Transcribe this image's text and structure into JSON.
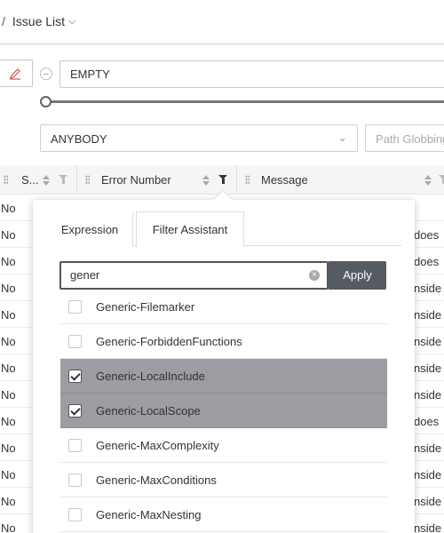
{
  "breadcrumb": {
    "separator": "/",
    "current": "Issue List",
    "chevron": "⌵"
  },
  "filter_bar": {
    "expression_value": "EMPTY",
    "assignee_value": "ANYBODY",
    "path_placeholder": "Path Globbing",
    "slider_value": 0
  },
  "table": {
    "columns": [
      {
        "label": "S...",
        "sort_icon": "sort-icon",
        "filter_icon": "filter-icon"
      },
      {
        "label": "Error Number",
        "sort_icon": "sort-icon",
        "filter_icon": "filter-icon",
        "filter_active": true
      },
      {
        "label": "Message",
        "sort_icon": "sort-icon",
        "filter_icon": "filter-icon"
      }
    ],
    "rows": [
      {
        "c1": "No",
        "c3": ""
      },
      {
        "c1": "No",
        "c3": "does"
      },
      {
        "c1": "No",
        "c3": "does"
      },
      {
        "c1": "No",
        "c3": "nside"
      },
      {
        "c1": "No",
        "c3": "nside"
      },
      {
        "c1": "No",
        "c3": "nside"
      },
      {
        "c1": "No",
        "c3": "nside"
      },
      {
        "c1": "No",
        "c3": "nside"
      },
      {
        "c1": "No",
        "c3": "does"
      },
      {
        "c1": "No",
        "c3": "nside"
      },
      {
        "c1": "No",
        "c3": "nside"
      },
      {
        "c1": "No",
        "c3": "nside"
      },
      {
        "c1": "No",
        "c3": "nside"
      }
    ]
  },
  "popup": {
    "tabs": [
      "Expression",
      "Filter Assistant"
    ],
    "active_tab": "Filter Assistant",
    "search_value": "gener",
    "clear_glyph": "×",
    "apply_label": "Apply",
    "options": [
      {
        "label": "Generic-Filemarker",
        "checked": false
      },
      {
        "label": "Generic-ForbiddenFunctions",
        "checked": false
      },
      {
        "label": "Generic-LocalInclude",
        "checked": true
      },
      {
        "label": "Generic-LocalScope",
        "checked": true
      },
      {
        "label": "Generic-MaxComplexity",
        "checked": false
      },
      {
        "label": "Generic-MaxConditions",
        "checked": false
      },
      {
        "label": "Generic-MaxNesting",
        "checked": false
      }
    ]
  },
  "colors": {
    "selected_row": "#9b9da3",
    "apply_button": "#555a63"
  }
}
